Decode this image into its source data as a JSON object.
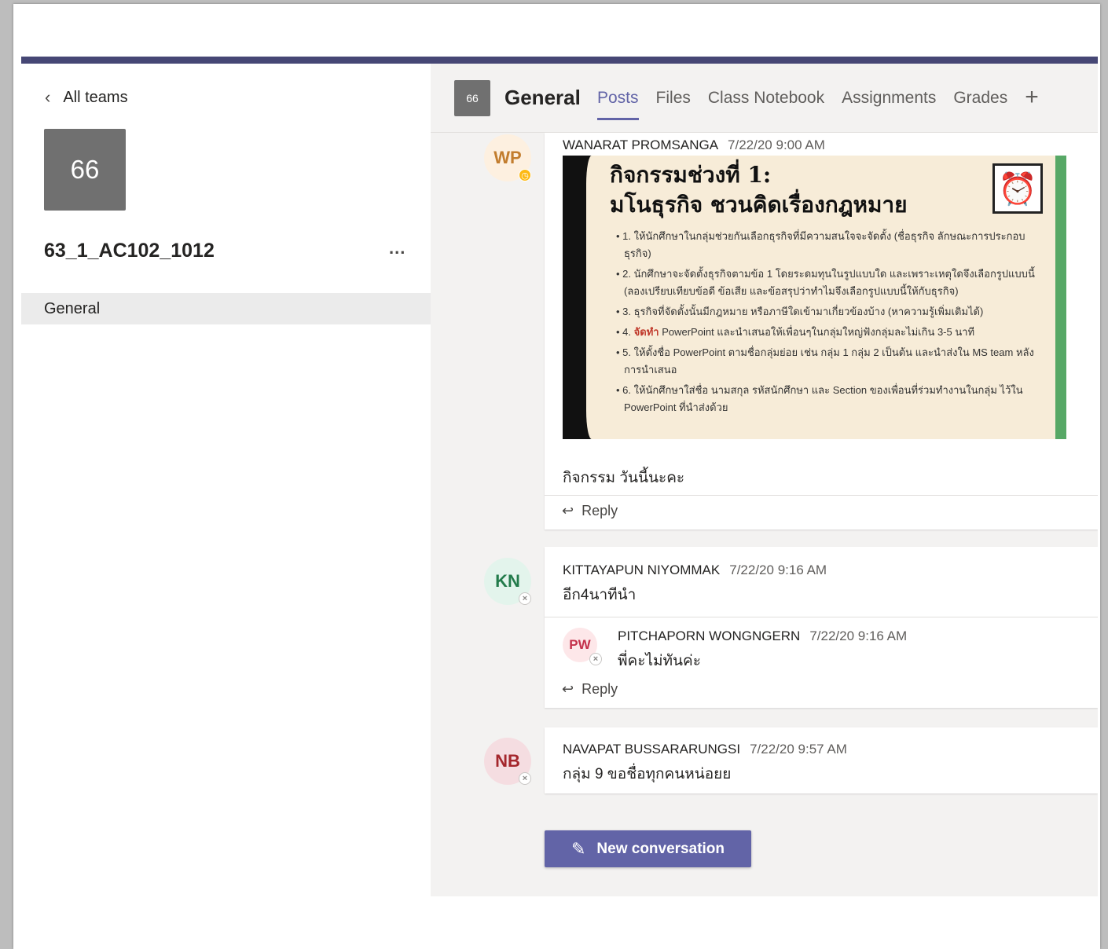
{
  "sidebar": {
    "back_label": "All teams",
    "team_tile": "66",
    "team_name": "63_1_AC102_1012",
    "more_label": "...",
    "channel": "General"
  },
  "header": {
    "tile": "66",
    "title": "General",
    "tabs": [
      "Posts",
      "Files",
      "Class Notebook",
      "Assignments",
      "Grades"
    ],
    "add_label": "+"
  },
  "posts": [
    {
      "initials": "WP",
      "author": "WANARAT PROMSANGA",
      "time": "7/22/20 9:00 AM",
      "avatar_bg": "#fdf0e0",
      "avatar_fg": "#c27d2e",
      "slide": {
        "title_line1": "กิจกรรมช่วงที่ 1:",
        "title_line2": "มโนธุรกิจ ชวนคิดเรื่องกฎหมาย",
        "bullets": [
          "1. ให้นักศึกษาในกลุ่มช่วยกันเลือกธุรกิจที่มีความสนใจจะจัดตั้ง (ชื่อธุรกิจ ลักษณะการประกอบธุรกิจ)",
          "2. นักศึกษาจะจัดตั้งธุรกิจตามข้อ 1 โดยระดมทุนในรูปแบบใด และเพราะเหตุใดจึงเลือกรูปแบบนี้ (ลองเปรียบเทียบข้อดี ข้อเสีย และข้อสรุปว่าทำไมจึงเลือกรูปแบบนี้ให้กับธุรกิจ)",
          "3. ธุรกิจที่จัดตั้งนั้นมีกฎหมาย หรือภาษีใดเข้ามาเกี่ยวข้องบ้าง (หาความรู้เพิ่มเติมได้)",
          "5. ให้ตั้งชื่อ PowerPoint ตามชื่อกลุ่มย่อย เช่น กลุ่ม 1 กลุ่ม 2 เป็นต้น และนำส่งใน MS team หลังการนำเสนอ",
          "6. ให้นักศึกษาใส่ชื่อ นามสกุล รหัสนักศึกษา และ Section ของเพื่อนที่ร่วมทำงานในกลุ่ม ไว้ใน PowerPoint ที่นำส่งด้วย"
        ],
        "bullet4_prefix": "4.",
        "bullet4_red": "จัดทำ",
        "bullet4_rest": "PowerPoint และนำเสนอให้เพื่อนๆในกลุ่มใหญ่ฟังกลุ่มละไม่เกิน 3-5 นาที"
      },
      "text": "กิจกรรม วันนี้นะคะ",
      "reply": "Reply"
    },
    {
      "initials": "KN",
      "author": "KITTAYAPUN NIYOMMAK",
      "time": "7/22/20 9:16 AM",
      "text": "อีก4นาทีนำ",
      "reply_item": {
        "initials": "PW",
        "author": "PITCHAPORN WONGNGERN",
        "time": "7/22/20 9:16 AM",
        "text": "พี่คะไม่ทันค่ะ"
      },
      "reply": "Reply"
    },
    {
      "initials": "NB",
      "author": "NAVAPAT BUSSARARUNGSI",
      "time": "7/22/20 9:57 AM",
      "text": "กลุ่ม 9 ขอชื่อทุกคนหน่อยย"
    }
  ],
  "new_conversation": "New conversation",
  "colors": {
    "accent": "#6264a7",
    "topbar": "#464775"
  }
}
